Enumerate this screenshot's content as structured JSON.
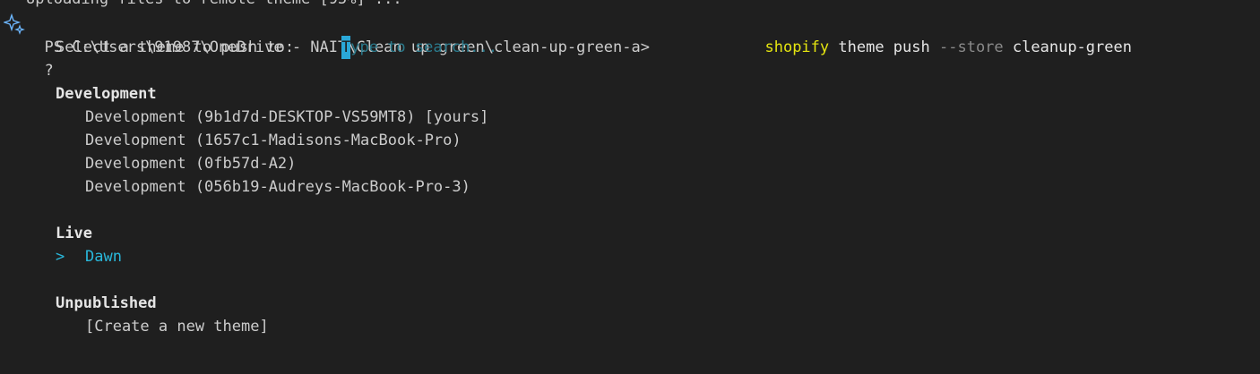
{
  "terminal": {
    "partial_top_line": "Uploading files to remote theme [95%] ...",
    "prompt_path": "PS C:\\Users\\91987\\OneDrive - NAIT\\Clean up green\\clean-up-green-a>",
    "command": {
      "program": "shopify",
      "args": "theme push",
      "flag": "--store",
      "value": "cleanup-green"
    },
    "question_mark": "?",
    "question": "Select a theme to push to:",
    "search_cursor_char": "T",
    "search_placeholder_rest": "ype to search...",
    "groups": [
      {
        "title": "Development",
        "items": [
          "Development (9b1d7d-DESKTOP-VS59MT8) [yours]",
          "Development (1657c1-Madisons-MacBook-Pro)",
          "Development (0fb57d-A2)",
          "Development (056b19-Audreys-MacBook-Pro-3)"
        ]
      },
      {
        "title": "Live",
        "selector": ">",
        "items": [
          "Dawn"
        ]
      },
      {
        "title": "Unpublished",
        "items": [
          "[Create a new theme]"
        ]
      }
    ],
    "colors": {
      "background": "#1f1f1f",
      "command_program": "#e5e510",
      "flag": "#8a8a8a",
      "selected": "#29b8db",
      "placeholder": "#2a7a8c"
    },
    "icons": {
      "gutter": "sparkle-icon"
    }
  }
}
